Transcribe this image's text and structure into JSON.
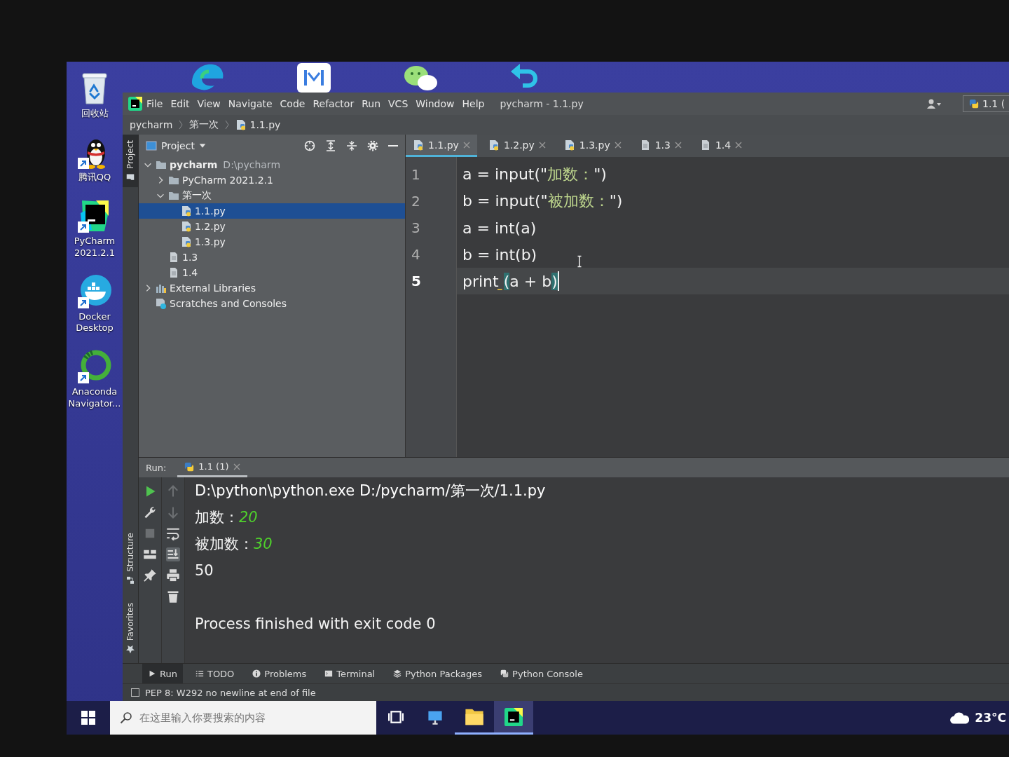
{
  "desktop": {
    "top_icons": [
      {
        "kind": "browser"
      },
      {
        "kind": "tile"
      },
      {
        "kind": "chat"
      },
      {
        "kind": "undo"
      }
    ],
    "side_icons": [
      {
        "kind": "recycle",
        "label": "回收站",
        "shortcut": false
      },
      {
        "kind": "qq",
        "label": "腾讯QQ",
        "shortcut": true
      },
      {
        "kind": "pycharm",
        "label": "PyCharm 2021.2.1",
        "shortcut": true
      },
      {
        "kind": "docker",
        "label": "Docker Desktop",
        "shortcut": true
      },
      {
        "kind": "anaconda",
        "label": "Anaconda Navigator...",
        "shortcut": true
      }
    ]
  },
  "window": {
    "menu": [
      "File",
      "Edit",
      "View",
      "Navigate",
      "Code",
      "Refactor",
      "Run",
      "VCS",
      "Window",
      "Help"
    ],
    "title": "pycharm - 1.1.py",
    "run_config": "1.1 (",
    "breadcrumb": [
      {
        "label": "pycharm",
        "kind": "dir"
      },
      {
        "label": "第一次",
        "kind": "dir"
      },
      {
        "label": "1.1.py",
        "kind": "python"
      }
    ],
    "side_tabs_top": [
      {
        "label": "Project",
        "kind": "project",
        "selected": true
      }
    ],
    "side_tabs_bottom": [
      {
        "label": "Structure",
        "kind": "structure",
        "selected": false
      },
      {
        "label": "Favorites",
        "kind": "favorites",
        "selected": false
      }
    ],
    "project": {
      "header": "Project",
      "tree": [
        {
          "label": "pycharm",
          "kind": "root",
          "path": "D:\\pycharm",
          "expanded": true,
          "selected": false,
          "children": [
            {
              "label": "PyCharm 2021.2.1",
              "kind": "folder",
              "expanded": false,
              "selected": false
            },
            {
              "label": "第一次",
              "kind": "folder",
              "expanded": true,
              "selected": false,
              "children": [
                {
                  "label": "1.1.py",
                  "kind": "python",
                  "selected": true
                },
                {
                  "label": "1.2.py",
                  "kind": "python",
                  "selected": false
                },
                {
                  "label": "1.3.py",
                  "kind": "python",
                  "selected": false
                }
              ]
            },
            {
              "label": "1.3",
              "kind": "text",
              "selected": false
            },
            {
              "label": "1.4",
              "kind": "text",
              "selected": false
            }
          ]
        },
        {
          "label": "External Libraries",
          "kind": "libraries",
          "expanded": false,
          "selected": false
        },
        {
          "label": "Scratches and Consoles",
          "kind": "scratches",
          "selected": false
        }
      ]
    },
    "editor": {
      "tabs": [
        {
          "label": "1.1.py",
          "kind": "python",
          "selected": true
        },
        {
          "label": "1.2.py",
          "kind": "python",
          "selected": false
        },
        {
          "label": "1.3.py",
          "kind": "python",
          "selected": false
        },
        {
          "label": "1.3",
          "kind": "text",
          "selected": false
        },
        {
          "label": "1.4",
          "kind": "text",
          "selected": false
        }
      ],
      "lines": [
        {
          "number": "1",
          "current": false,
          "tokens": [
            {
              "kind": "code",
              "text": "a = input(\""
            },
            {
              "kind": "string",
              "text": "加数："
            },
            {
              "kind": "code",
              "text": "\")"
            }
          ]
        },
        {
          "number": "2",
          "current": false,
          "tokens": [
            {
              "kind": "code",
              "text": "b = input(\""
            },
            {
              "kind": "string",
              "text": "被加数："
            },
            {
              "kind": "code",
              "text": "\")"
            }
          ]
        },
        {
          "number": "3",
          "current": false,
          "tokens": [
            {
              "kind": "code",
              "text": "a = int(a)"
            }
          ]
        },
        {
          "number": "4",
          "current": false,
          "tokens": [
            {
              "kind": "code",
              "text": "b = int(b)"
            }
          ]
        },
        {
          "number": "5",
          "current": true,
          "tokens": [
            {
              "kind": "warning",
              "text": "print "
            },
            {
              "kind": "brace",
              "text": "("
            },
            {
              "kind": "code",
              "text": "a + b"
            },
            {
              "kind": "brace",
              "text": ")"
            }
          ]
        }
      ]
    },
    "run": {
      "label": "Run:",
      "tabs": [
        {
          "label": "1.1 (1)",
          "kind": "python",
          "selected": true
        }
      ],
      "toolbar": [
        {
          "kind": "rerun",
          "disabled": false
        },
        {
          "kind": "settings",
          "disabled": false
        },
        {
          "kind": "stop",
          "disabled": true
        },
        {
          "kind": "layout",
          "disabled": false
        },
        {
          "kind": "pin",
          "disabled": false
        }
      ],
      "toolbar_2": [
        {
          "kind": "up",
          "disabled": true,
          "on": false
        },
        {
          "kind": "down",
          "disabled": true,
          "on": false
        },
        {
          "kind": "wrap",
          "disabled": false,
          "on": false
        },
        {
          "kind": "scroll_end",
          "disabled": false,
          "on": true
        },
        {
          "kind": "print",
          "disabled": false,
          "on": false
        },
        {
          "kind": "clear",
          "disabled": false,
          "on": false
        }
      ],
      "console": [
        {
          "kind": "command",
          "text": "D:\\python\\python.exe D:/pycharm/第一次/1.1.py"
        },
        {
          "kind": "prompt",
          "text": "加数：",
          "input": "20"
        },
        {
          "kind": "prompt",
          "text": "被加数：",
          "input": "30"
        },
        {
          "kind": "output",
          "text": "50"
        },
        {
          "kind": "exit",
          "text": "Process finished with exit code 0"
        }
      ]
    },
    "tool_tabs": [
      {
        "label": "Run",
        "kind": "run",
        "selected": true
      },
      {
        "label": "TODO",
        "kind": "todo",
        "selected": false
      },
      {
        "label": "Problems",
        "kind": "problems",
        "selected": false
      },
      {
        "label": "Terminal",
        "kind": "terminal",
        "selected": false
      },
      {
        "label": "Python Packages",
        "kind": "packages",
        "selected": false
      },
      {
        "label": "Python Console",
        "kind": "console",
        "selected": false
      }
    ],
    "status": "PEP 8: W292 no newline at end of file"
  },
  "taskbar": {
    "search": {
      "placeholder": "在这里输入你要搜索的内容"
    },
    "apps": [
      {
        "kind": "task_view",
        "selected": false,
        "running": false
      },
      {
        "kind": "computer",
        "selected": false,
        "running": false
      },
      {
        "kind": "explorer",
        "selected": false,
        "running": true
      },
      {
        "kind": "pycharm",
        "selected": true,
        "running": true
      }
    ],
    "weather": "23°C"
  }
}
